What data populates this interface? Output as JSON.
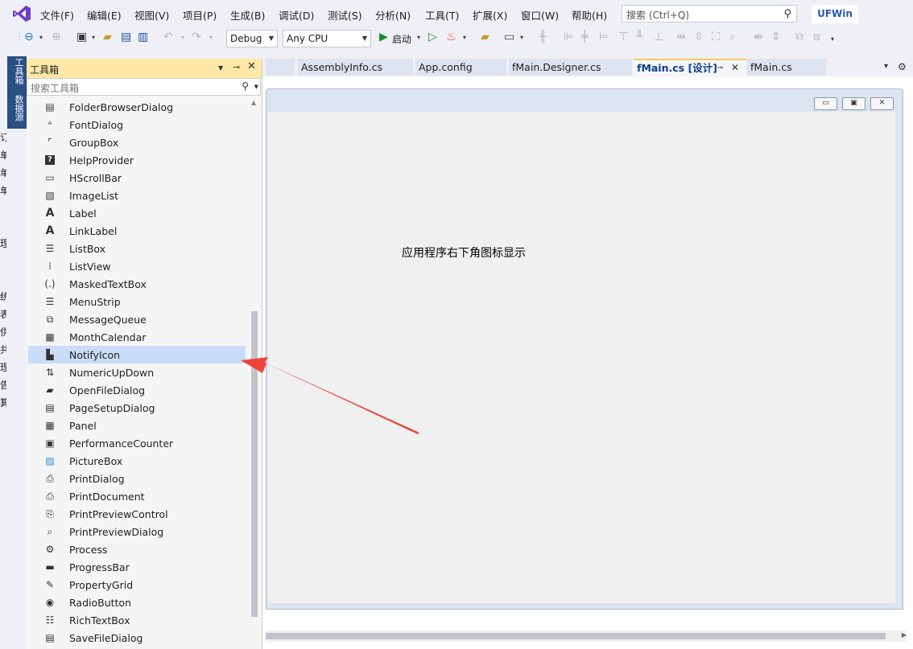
{
  "menu": {
    "items": [
      "文件(F)",
      "编辑(E)",
      "视图(V)",
      "项目(P)",
      "生成(B)",
      "调试(D)",
      "测试(S)",
      "分析(N)",
      "工具(T)",
      "扩展(X)",
      "窗口(W)",
      "帮助(H)"
    ],
    "search_placeholder": "搜索 (Ctrl+Q)",
    "solution_name": "UFWin"
  },
  "toolbar": {
    "config": "Debug",
    "platform": "Any CPU",
    "start_label": "启动"
  },
  "left_rail": {
    "tabs": [
      "工具箱",
      "数据源"
    ],
    "fragments": [
      "订",
      "单",
      "单",
      "单",
      "",
      "",
      "理",
      "",
      "",
      "统",
      "表",
      "供",
      "共",
      "理",
      "告",
      "算"
    ]
  },
  "toolbox": {
    "title": "工具箱",
    "search_placeholder": "搜索工具箱",
    "items": [
      {
        "label": "FolderBrowserDialog",
        "icon": "folder-browser-icon"
      },
      {
        "label": "FontDialog",
        "icon": "font-dialog-icon"
      },
      {
        "label": "GroupBox",
        "icon": "groupbox-icon"
      },
      {
        "label": "HelpProvider",
        "icon": "help-provider-icon"
      },
      {
        "label": "HScrollBar",
        "icon": "hscrollbar-icon"
      },
      {
        "label": "ImageList",
        "icon": "imagelist-icon"
      },
      {
        "label": "Label",
        "icon": "label-icon"
      },
      {
        "label": "LinkLabel",
        "icon": "linklabel-icon"
      },
      {
        "label": "ListBox",
        "icon": "listbox-icon"
      },
      {
        "label": "ListView",
        "icon": "listview-icon"
      },
      {
        "label": "MaskedTextBox",
        "icon": "masked-textbox-icon"
      },
      {
        "label": "MenuStrip",
        "icon": "menustrip-icon"
      },
      {
        "label": "MessageQueue",
        "icon": "message-queue-icon"
      },
      {
        "label": "MonthCalendar",
        "icon": "month-calendar-icon"
      },
      {
        "label": "NotifyIcon",
        "icon": "notify-icon-icon",
        "selected": true
      },
      {
        "label": "NumericUpDown",
        "icon": "numeric-updown-icon"
      },
      {
        "label": "OpenFileDialog",
        "icon": "open-file-dialog-icon"
      },
      {
        "label": "PageSetupDialog",
        "icon": "page-setup-dialog-icon"
      },
      {
        "label": "Panel",
        "icon": "panel-icon"
      },
      {
        "label": "PerformanceCounter",
        "icon": "performance-counter-icon"
      },
      {
        "label": "PictureBox",
        "icon": "picturebox-icon"
      },
      {
        "label": "PrintDialog",
        "icon": "print-dialog-icon"
      },
      {
        "label": "PrintDocument",
        "icon": "print-document-icon"
      },
      {
        "label": "PrintPreviewControl",
        "icon": "print-preview-control-icon"
      },
      {
        "label": "PrintPreviewDialog",
        "icon": "print-preview-dialog-icon"
      },
      {
        "label": "Process",
        "icon": "process-icon"
      },
      {
        "label": "ProgressBar",
        "icon": "progressbar-icon"
      },
      {
        "label": "PropertyGrid",
        "icon": "property-grid-icon"
      },
      {
        "label": "RadioButton",
        "icon": "radiobutton-icon"
      },
      {
        "label": "RichTextBox",
        "icon": "richtextbox-icon"
      },
      {
        "label": "SaveFileDialog",
        "icon": "save-file-dialog-icon"
      }
    ]
  },
  "doc_tabs": [
    {
      "label": "AssemblyInfo.cs",
      "active": false
    },
    {
      "label": "App.config",
      "active": false
    },
    {
      "label": "fMain.Designer.cs",
      "active": false
    },
    {
      "label": "fMain.cs [设计]",
      "active": true
    },
    {
      "label": "fMain.cs",
      "active": false
    }
  ],
  "designer": {
    "form_label": "应用程序右下角图标显示"
  },
  "colors": {
    "toolbox_header": "#ffe8a6",
    "selection": "#c9dcf8",
    "active_tab_accent": "#f5cc5a",
    "rail_tab_bg": "#2b4f86",
    "annotation_arrow": "#f0433a"
  }
}
